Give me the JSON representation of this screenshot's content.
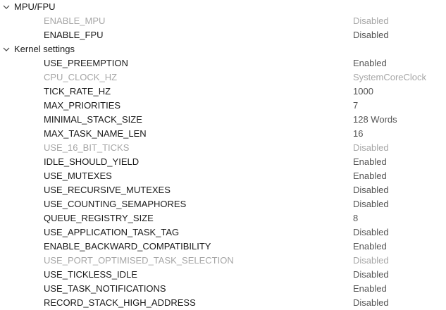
{
  "groups": [
    {
      "label": "MPU/FPU",
      "expanded": true,
      "params": [
        {
          "name": "ENABLE_MPU",
          "value": "Disabled",
          "greyed": true
        },
        {
          "name": "ENABLE_FPU",
          "value": "Disabled",
          "greyed": false
        }
      ]
    },
    {
      "label": "Kernel settings",
      "expanded": true,
      "params": [
        {
          "name": "USE_PREEMPTION",
          "value": "Enabled",
          "greyed": false
        },
        {
          "name": "CPU_CLOCK_HZ",
          "value": "SystemCoreClock",
          "greyed": true
        },
        {
          "name": "TICK_RATE_HZ",
          "value": "1000",
          "greyed": false
        },
        {
          "name": "MAX_PRIORITIES",
          "value": "7",
          "greyed": false
        },
        {
          "name": "MINIMAL_STACK_SIZE",
          "value": "128 Words",
          "greyed": false
        },
        {
          "name": "MAX_TASK_NAME_LEN",
          "value": "16",
          "greyed": false
        },
        {
          "name": "USE_16_BIT_TICKS",
          "value": "Disabled",
          "greyed": true
        },
        {
          "name": "IDLE_SHOULD_YIELD",
          "value": "Enabled",
          "greyed": false
        },
        {
          "name": "USE_MUTEXES",
          "value": "Enabled",
          "greyed": false
        },
        {
          "name": "USE_RECURSIVE_MUTEXES",
          "value": "Disabled",
          "greyed": false
        },
        {
          "name": "USE_COUNTING_SEMAPHORES",
          "value": "Disabled",
          "greyed": false
        },
        {
          "name": "QUEUE_REGISTRY_SIZE",
          "value": "8",
          "greyed": false
        },
        {
          "name": "USE_APPLICATION_TASK_TAG",
          "value": "Disabled",
          "greyed": false
        },
        {
          "name": "ENABLE_BACKWARD_COMPATIBILITY",
          "value": "Enabled",
          "greyed": false
        },
        {
          "name": "USE_PORT_OPTIMISED_TASK_SELECTION",
          "value": "Disabled",
          "greyed": true
        },
        {
          "name": "USE_TICKLESS_IDLE",
          "value": "Disabled",
          "greyed": false
        },
        {
          "name": "USE_TASK_NOTIFICATIONS",
          "value": "Enabled",
          "greyed": false
        },
        {
          "name": "RECORD_STACK_HIGH_ADDRESS",
          "value": "Disabled",
          "greyed": false
        }
      ]
    }
  ],
  "icons": {
    "expander": "chevron-down-icon"
  },
  "colors": {
    "text": "#1a1a1a",
    "value_text": "#555555",
    "greyed_text": "#a6a6a6",
    "background": "#ffffff"
  }
}
